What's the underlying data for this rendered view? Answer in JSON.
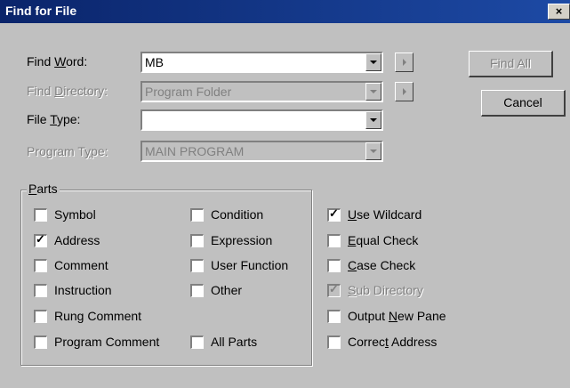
{
  "window": {
    "title": "Find for File",
    "close": "×"
  },
  "find_word": {
    "label_pre": "Find ",
    "label_key": "W",
    "label_post": "ord:",
    "value": "MB"
  },
  "find_directory": {
    "label_pre": "Find ",
    "label_key": "D",
    "label_post": "irectory:",
    "value": "Program Folder"
  },
  "file_type": {
    "label_pre": "File ",
    "label_key": "T",
    "label_post": "ype:",
    "value": ""
  },
  "program_type": {
    "label_pre": "Program T",
    "label_key": "y",
    "label_post": "pe:",
    "value": "MAIN PROGRAM"
  },
  "buttons": {
    "find_all": "Find All",
    "cancel": "Cancel"
  },
  "parts": {
    "label_key": "P",
    "label_post": "arts",
    "col1": [
      {
        "label": "Symbol",
        "checked": false
      },
      {
        "label": "Address",
        "checked": true
      },
      {
        "label": "Comment",
        "checked": false
      },
      {
        "label": "Instruction",
        "checked": false
      },
      {
        "label": "Rung Comment",
        "checked": false
      },
      {
        "label": "Program Comment",
        "checked": false
      }
    ],
    "col2": [
      {
        "label": "Condition",
        "checked": false
      },
      {
        "label": "Expression",
        "checked": false
      },
      {
        "label": "User Function",
        "checked": false
      },
      {
        "label": "Other",
        "checked": false
      },
      {
        "label": "All Parts",
        "checked": false
      }
    ]
  },
  "options": [
    {
      "pre": "",
      "key": "U",
      "post": "se Wildcard",
      "checked": true,
      "disabled": false
    },
    {
      "pre": "",
      "key": "E",
      "post": "qual Check",
      "checked": false,
      "disabled": false
    },
    {
      "pre": "",
      "key": "C",
      "post": "ase Check",
      "checked": false,
      "disabled": false
    },
    {
      "pre": "",
      "key": "S",
      "post": "ub Directory",
      "checked": true,
      "disabled": true
    },
    {
      "pre": "Output ",
      "key": "N",
      "post": "ew Pane",
      "checked": false,
      "disabled": false
    },
    {
      "pre": "Correc",
      "key": "t",
      "post": " Address",
      "checked": false,
      "disabled": false
    }
  ],
  "check_glyph": "✓"
}
